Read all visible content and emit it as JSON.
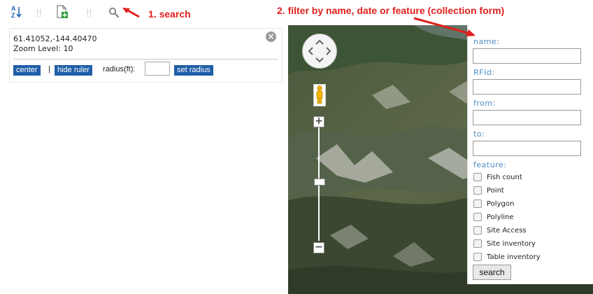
{
  "toolbar": {
    "sort_icon_text": "AZ",
    "icons": [
      "sort-az-icon",
      "add-document-icon",
      "search-icon"
    ]
  },
  "annotations": {
    "search": "1. search",
    "filter": "2. filter by name, date or feature (collection form)"
  },
  "info": {
    "coords": "61.41052,-144.40470",
    "zoom": "Zoom Level: 10",
    "center_label": "center",
    "separator": "|",
    "hide_ruler_label": "hide ruler",
    "radius_label": "radius(ft):",
    "radius_value": "",
    "set_radius_label": "set radius"
  },
  "filter": {
    "name_label": "name:",
    "rfid_label": "RFId:",
    "from_label": "from:",
    "to_label": "to:",
    "feature_label": "feature:",
    "features": [
      {
        "label": "Fish count",
        "checked": false
      },
      {
        "label": "Point",
        "checked": false
      },
      {
        "label": "Polygon",
        "checked": false
      },
      {
        "label": "Polyline",
        "checked": false
      },
      {
        "label": "Site Access",
        "checked": false
      },
      {
        "label": "Site inventory",
        "checked": false
      },
      {
        "label": "Table inventory",
        "checked": false
      }
    ],
    "search_label": "search"
  },
  "map": {
    "zoom_in": "+",
    "zoom_out": "−"
  },
  "colors": {
    "annotation": "#e0201b",
    "button_blue": "#1f5ea8",
    "label_blue": "#4d8ac2"
  }
}
